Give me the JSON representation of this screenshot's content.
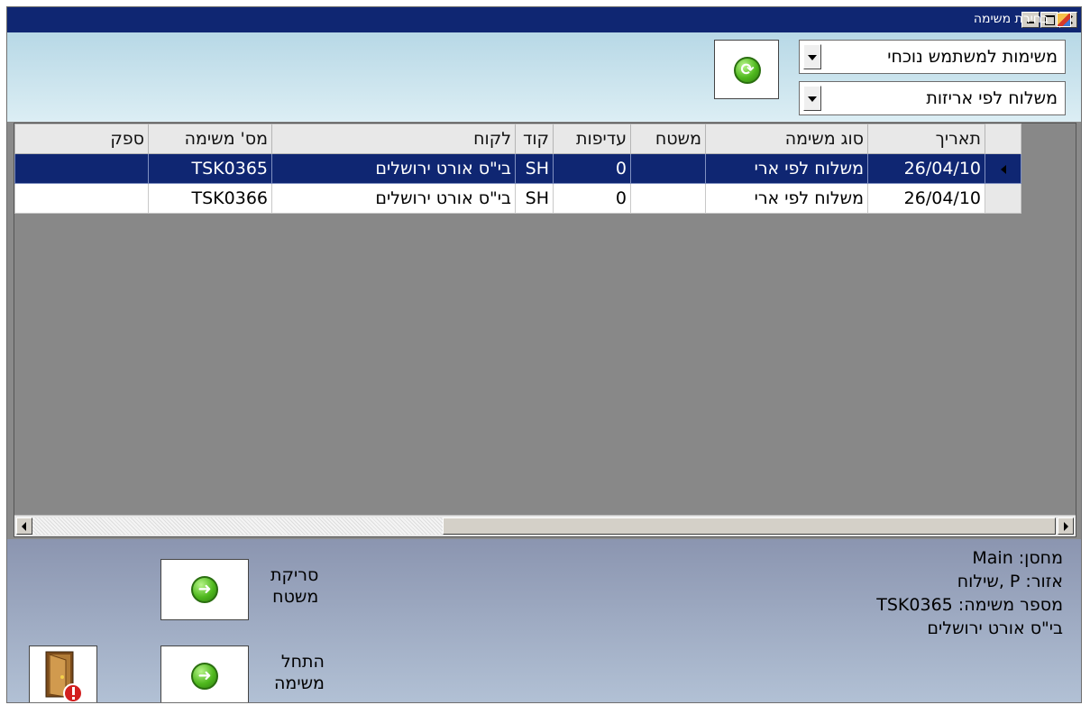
{
  "window": {
    "title": "בחירת משימה",
    "buttons": [
      "minimize",
      "maximize",
      "close"
    ]
  },
  "filters": {
    "user_tasks": "משימות למשתמש נוכחי",
    "task_type": "משלוח לפי אריזות",
    "refresh_icon": "refresh-icon"
  },
  "table": {
    "columns": [
      "תאריך",
      "סוג משימה",
      "משטח",
      "עדיפות",
      "קוד",
      "לקוח",
      "מס' משימה",
      "ספק"
    ],
    "rows": [
      {
        "date": "26/04/10",
        "type": "משלוח לפי ארי",
        "pallet": "",
        "priority": "0",
        "code": "SH",
        "customer": "בי\"ס אורט ירושלים",
        "task_no": "TSK0365",
        "supplier": "",
        "selected": true
      },
      {
        "date": "26/04/10",
        "type": "משלוח לפי ארי",
        "pallet": "",
        "priority": "0",
        "code": "SH",
        "customer": "בי\"ס אורט ירושלים",
        "task_no": "TSK0366",
        "supplier": "",
        "selected": false
      }
    ]
  },
  "info": {
    "warehouse": "מחסן: Main",
    "zone": "אזור: P ,שילוח",
    "task_number": "מספר משימה: TSK0365",
    "customer": "בי\"ס אורט ירושלים"
  },
  "actions": {
    "scan_pallet": {
      "line1": "סריקת",
      "line2": "משטח"
    },
    "start_task": {
      "line1": "התחל",
      "line2": "משימה"
    },
    "exit_icon": "exit-door-icon"
  },
  "colors": {
    "titlebar": "#0f2672",
    "selected_row": "#0f2672",
    "grid_background": "#888888",
    "top_panel": "#cfe7f0",
    "bottom_panel": "#a5b4cc"
  }
}
